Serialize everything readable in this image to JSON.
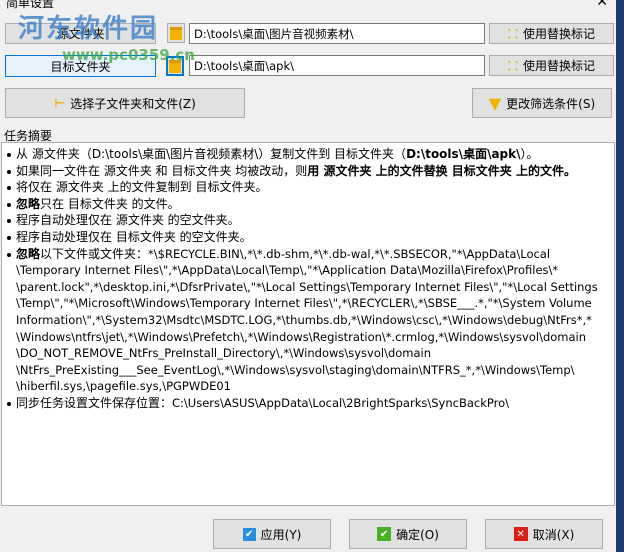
{
  "window": {
    "title": "简单设置",
    "close": "✕"
  },
  "watermark": {
    "name": "河东软件园",
    "url": "www.pc0359.cn"
  },
  "source": {
    "button": "源文件夹",
    "path": "D:\\tools\\桌面\\图片音视频素材\\",
    "replace_button": "使用替换标记"
  },
  "target": {
    "button": "目标文件夹",
    "path": "D:\\tools\\桌面\\apk\\",
    "replace_button": "使用替换标记"
  },
  "actions": {
    "select_subfolders": "选择子文件夹和文件(Z)",
    "change_filter": "更改筛选条件(S)"
  },
  "summary": {
    "label": "任务摘要",
    "l1a": "从 源文件夹（D:\\tools\\桌面\\图片音视频素材\\）复制文件到 目标文件夹（",
    "l1b": "D:\\tools\\桌面\\apk\\",
    "l1c": "）。",
    "l2a": "如果同一文件在 源文件夹 和 目标文件夹 均被改动，则",
    "l2b": "用 源文件夹 上的文件替换 目标文件夹 上的文件。",
    "l3": "将仅在 源文件夹 上的文件复制到 目标文件夹。",
    "l4a": "忽略",
    "l4b": "只在 目标文件夹 的文件。",
    "l5": "程序自动处理仅在 源文件夹 的空文件夹。",
    "l6": "程序自动处理仅在 目标文件夹 的空文件夹。",
    "l7a": "忽略",
    "l7b": "以下文件或文件夹：",
    "l7c": "*\\$RECYCLE.BIN\\,*\\*.db-shm,*\\*.db-wal,*\\*.SBSECOR,\"*\\AppData\\Local \\Temporary Internet Files\\\",*\\AppData\\Local\\Temp\\,\"*\\Application Data\\Mozilla\\Firefox\\Profiles\\* \\parent.lock\",*\\desktop.ini,*\\DfsrPrivate\\,\"*\\Local Settings\\Temporary Internet Files\\\",\"*\\Local Settings \\Temp\\\",\"*\\Microsoft\\Windows\\Temporary Internet Files\\\",*\\RECYCLER\\,*\\SBSE___.*,\"*\\System Volume Information\\\",*\\System32\\Msdtc\\MSDTC.LOG,*\\thumbs.db,*\\Windows\\csc\\,*\\Windows\\debug\\NtFrs*,* \\Windows\\ntfrs\\jet\\,*\\Windows\\Prefetch\\,*\\Windows\\Registration\\*.crmlog,*\\Windows\\sysvol\\domain \\DO_NOT_REMOVE_NtFrs_PreInstall_Directory\\,*\\Windows\\sysvol\\domain \\NtFrs_PreExisting___See_EventLog\\,*\\Windows\\sysvol\\staging\\domain\\NTFRS_*,*\\Windows\\Temp\\ \\hiberfil.sys,\\pagefile.sys,\\PGPWDE01",
    "l8a": "同步任务设置文件保存位置：",
    "l8b": "C:\\Users\\ASUS\\AppData\\Local\\2BrightSparks\\SyncBackPro\\"
  },
  "footer": {
    "apply": "应用(Y)",
    "ok": "确定(O)",
    "cancel": "取消(X)"
  },
  "colors": {
    "accent": "#0078d7",
    "folder": "#f2b200",
    "ok": "#4caf28",
    "cancel": "#d91e18"
  }
}
